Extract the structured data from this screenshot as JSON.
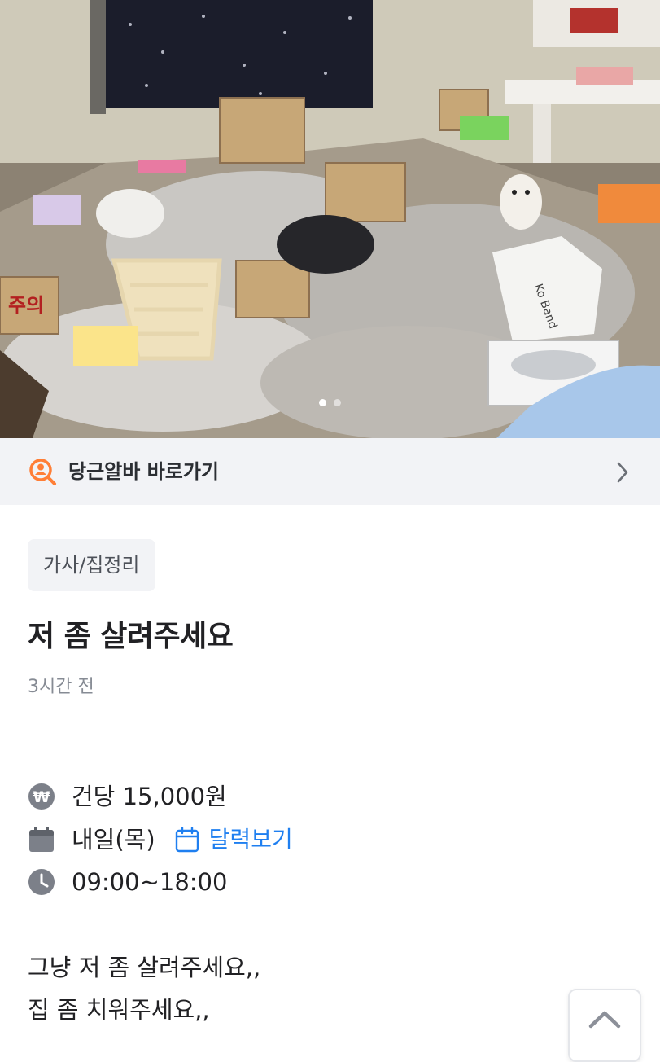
{
  "photo": {
    "pages": 2,
    "current_page": 1,
    "box_text_left": "주의",
    "bag_text": "Ko Band"
  },
  "banner": {
    "icon": "search-person-icon",
    "label": "당근알바 바로가기",
    "chevron": "chevron-right-icon",
    "accent": "#ff7e36"
  },
  "post": {
    "category": "가사/집정리",
    "title": "저 좀 살려주세요",
    "time_ago": "3시간 전"
  },
  "details": {
    "pay": {
      "icon": "won-icon",
      "text": "건당 15,000원"
    },
    "date": {
      "icon": "calendar-icon",
      "text": "내일(목)",
      "calendar_link": "달력보기",
      "link_color": "#1f7ff0"
    },
    "time": {
      "icon": "clock-icon",
      "text": "09:00~18:00"
    }
  },
  "description": {
    "line1": "그냥 저 좀 살려주세요,,",
    "line2": "집 좀 치워주세요,,"
  },
  "scroll_top": {
    "icon": "chevron-up-icon"
  }
}
